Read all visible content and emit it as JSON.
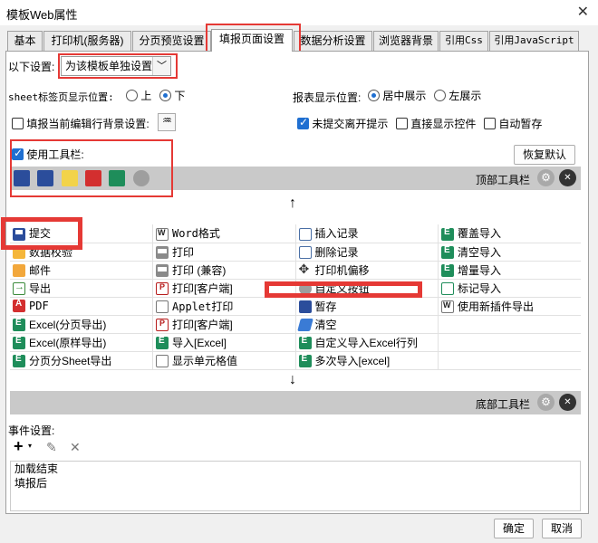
{
  "window": {
    "title": "模板Web属性",
    "close_glyph": "✕"
  },
  "tabs": [
    {
      "label": "基本",
      "mono": false
    },
    {
      "label": "打印机(服务器)",
      "mono": false
    },
    {
      "label": "分页预览设置",
      "mono": false
    },
    {
      "label": "填报页面设置",
      "mono": false,
      "active": true
    },
    {
      "label": "数据分析设置",
      "mono": false
    },
    {
      "label": "浏览器背景",
      "mono": false
    },
    {
      "label": "引用Css",
      "mono": true
    },
    {
      "label": "引用JavaScript",
      "mono": true
    }
  ],
  "settings": {
    "scope_label": "以下设置:",
    "scope_value": "为该模板单独设置",
    "sheet_tab_label": "sheet标签页显示位置:",
    "sheet_top": "上",
    "sheet_bottom": "下",
    "report_pos_label": "报表显示位置:",
    "center": "居中展示",
    "left": "左展示",
    "fill_bg_label": "填报当前编辑行背景设置:",
    "unsubmit_label": "未提交离开提示",
    "direct_ctrl_label": "直接显示控件",
    "autosave_label": "自动暂存",
    "use_toolbar_label": "使用工具栏:",
    "restore_default": "恢复默认"
  },
  "toolbar": {
    "top_label": "顶部工具栏",
    "bottom_label": "底部工具栏",
    "up_arrow": "↑",
    "down_arrow": "↓",
    "gear_glyph": "⚙",
    "remove_glyph": "✕"
  },
  "grid": [
    [
      {
        "icon": "save",
        "label": "提交"
      },
      {
        "icon": "word",
        "label": "Word格式",
        "mono": true
      },
      {
        "icon": "insert",
        "label": "插入记录"
      },
      {
        "icon": "excel",
        "label": "覆盖导入"
      }
    ],
    [
      {
        "icon": "check",
        "label": "数据校验"
      },
      {
        "icon": "print",
        "label": "打印"
      },
      {
        "icon": "del",
        "label": "删除记录"
      },
      {
        "icon": "excel",
        "label": "清空导入"
      }
    ],
    [
      {
        "icon": "mail",
        "label": "邮件"
      },
      {
        "icon": "print",
        "label": "打印 (兼容)"
      },
      {
        "icon": "move",
        "label": "打印机偏移"
      },
      {
        "icon": "excel",
        "label": "增量导入"
      }
    ],
    [
      {
        "icon": "export",
        "label": "导出"
      },
      {
        "icon": "redprint",
        "label": "打印[客户端]"
      },
      {
        "icon": "gear",
        "label": "自定义按钮"
      },
      {
        "icon": "mark",
        "label": "标记导入"
      }
    ],
    [
      {
        "icon": "pdf",
        "label": "PDF",
        "mono": true
      },
      {
        "icon": "applet",
        "label": "Applet打印",
        "mono": true
      },
      {
        "icon": "pause",
        "label": "暂存"
      },
      {
        "icon": "word",
        "label": "使用新插件导出"
      }
    ],
    [
      {
        "icon": "excel",
        "label": "Excel(分页导出)"
      },
      {
        "icon": "redprint",
        "label": "打印[客户端]"
      },
      {
        "icon": "erase",
        "label": "清空"
      },
      {
        "icon": "",
        "label": ""
      }
    ],
    [
      {
        "icon": "excel",
        "label": "Excel(原样导出)"
      },
      {
        "icon": "excel",
        "label": "导入[Excel]"
      },
      {
        "icon": "excel",
        "label": "自定义导入Excel行列"
      },
      {
        "icon": "",
        "label": ""
      }
    ],
    [
      {
        "icon": "excel",
        "label": "分页分Sheet导出"
      },
      {
        "icon": "cell",
        "label": "显示单元格值"
      },
      {
        "icon": "excel",
        "label": "多次导入[excel]"
      },
      {
        "icon": "",
        "label": ""
      }
    ]
  ],
  "events": {
    "label": "事件设置:",
    "add_glyph": "+",
    "edit_glyph": "✎",
    "delete_glyph": "✕",
    "items": [
      "加载结束",
      "填报后"
    ]
  },
  "footer": {
    "ok": "确定",
    "cancel": "取消"
  },
  "colors": {
    "highlight": "#e53935",
    "accent": "#1f6fd1",
    "band": "#c9c9c9"
  }
}
